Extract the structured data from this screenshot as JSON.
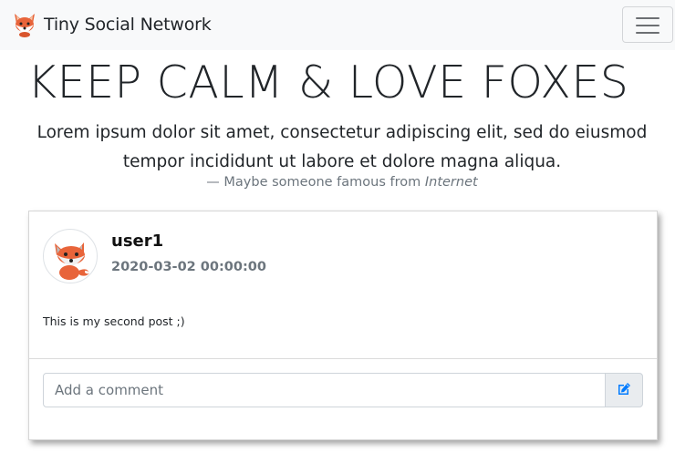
{
  "navbar": {
    "brand_text": "Tiny Social Network",
    "logo_icon": "fox-icon",
    "menu_icon": "hamburger-menu-icon"
  },
  "hero": {
    "headline": "KEEP CALM & LOVE FOXES",
    "quote": "Lorem ipsum dolor sit amet, consectetur adipiscing elit, sed do eiusmod tempor incididunt ut labore et dolore magna aliqua.",
    "attribution_prefix": "— Maybe someone famous from ",
    "attribution_source": "Internet"
  },
  "post": {
    "avatar_icon": "fox-avatar-icon",
    "username": "user1",
    "timestamp": "2020-03-02 00:00:00",
    "text": "This is my second post ;)"
  },
  "comment": {
    "placeholder": "Add a comment",
    "value": "",
    "submit_icon": "edit-icon"
  },
  "colors": {
    "navbar_bg": "#f8f9fa",
    "accent": "#007bff",
    "fox_orange": "#e8643a",
    "muted": "#6c757d"
  }
}
